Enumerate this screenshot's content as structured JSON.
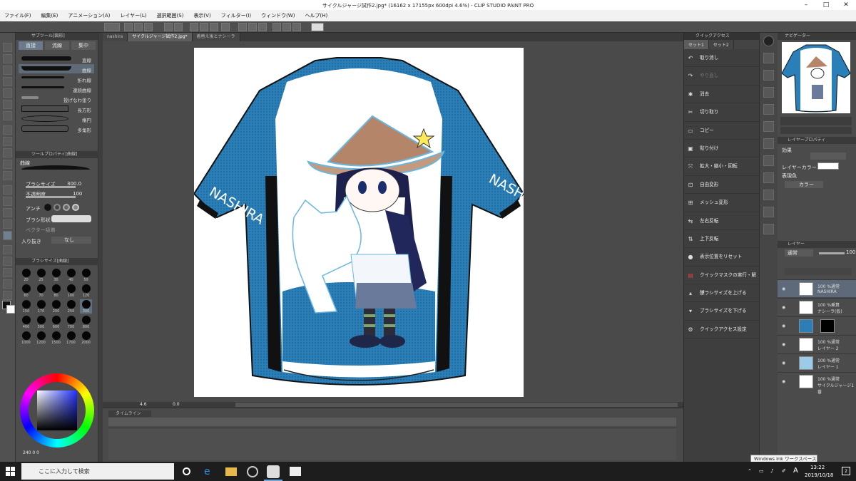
{
  "title": "サイクルジャージ試作2.jpg* (16162 x 17155px 600dpi 4.6%) - CLIP STUDIO PAINT PRO",
  "menu": [
    "ファイル(F)",
    "編集(E)",
    "アニメーション(A)",
    "レイヤー(L)",
    "選択範囲(S)",
    "表示(V)",
    "フィルター(I)",
    "ウィンドウ(W)",
    "ヘルプ(H)"
  ],
  "tabs": [
    "nashira",
    "サイクルジャージ試作2.jpg*",
    "着替え後とナシーラ"
  ],
  "subtool": {
    "header": "サブツール[図形]",
    "tabs": [
      "直接",
      "流線",
      "集中"
    ],
    "items": [
      "直線",
      "曲線",
      "折れ線",
      "連続曲線",
      "投げなわ塗り",
      "長方形",
      "楕円",
      "多角形"
    ]
  },
  "toolprop": {
    "header": "ツールプロパティ[曲線]",
    "name": "曲線",
    "brush_size_label": "ブラシサイズ",
    "brush_size_value": "300.0",
    "opacity_label": "不透明度",
    "opacity_value": "100",
    "antialias_label": "アンチ",
    "brush_shape_label": "ブラシ形状",
    "vector_label": "ベクター吸着",
    "taper_label": "入り抜き",
    "taper_value": "なし"
  },
  "brushsize": {
    "header": "ブラシサイズ[曲線]",
    "sizes": [
      "20",
      "25",
      "30",
      "40",
      "50",
      "60",
      "70",
      "80",
      "100",
      "120",
      "150",
      "170",
      "200",
      "250",
      "300",
      "400",
      "500",
      "600",
      "700",
      "800",
      "1000",
      "1200",
      "1500",
      "1700",
      "2000"
    ]
  },
  "navigator_bottom": {
    "zoom": "4.6",
    "angle": "0.0",
    "color_nums": [
      "240",
      "0",
      "0"
    ]
  },
  "timeline_header": "タイムライン",
  "quickaccess": {
    "header": "クイックアクセス",
    "tabs": [
      "セット1",
      "セット2"
    ],
    "items": [
      {
        "icon": "↶",
        "label": "取り消し",
        "dim": false
      },
      {
        "icon": "↷",
        "label": "やり直し",
        "dim": true
      },
      {
        "icon": "✱",
        "label": "消去",
        "dim": false
      },
      {
        "icon": "✂",
        "label": "切り取り",
        "dim": false
      },
      {
        "icon": "▭",
        "label": "コピー",
        "dim": false
      },
      {
        "icon": "▣",
        "label": "貼り付け",
        "dim": false
      },
      {
        "icon": "⤧",
        "label": "拡大・縮小・回転",
        "dim": false
      },
      {
        "icon": "⊡",
        "label": "自由変形",
        "dim": false
      },
      {
        "icon": "⊞",
        "label": "メッシュ変形",
        "dim": false
      },
      {
        "icon": "⇆",
        "label": "左右反転",
        "dim": false
      },
      {
        "icon": "⇅",
        "label": "上下反転",
        "dim": false
      },
      {
        "icon": "●",
        "label": "表示位置をリセット",
        "dim": false
      },
      {
        "icon": "▤",
        "label": "クイックマスクの実行・解除",
        "dim": false
      },
      {
        "icon": "▴",
        "label": "ブラシサイズを上げる",
        "dim": false
      },
      {
        "icon": "▾",
        "label": "ブラシサイズを下げる",
        "dim": false
      },
      {
        "icon": "⚙",
        "label": "クイックアクセス設定",
        "dim": false
      }
    ]
  },
  "navigator": {
    "header": "ナビゲーター"
  },
  "layerprop": {
    "header": "レイヤープロパティ",
    "effect_label": "効果",
    "layercolor_label": "レイヤーカラー",
    "expression_label": "表現色",
    "expression_value": "カラー"
  },
  "layers": {
    "header": "レイヤー",
    "blend": "通常",
    "opacity": "100",
    "items": [
      {
        "l1": "100 %通常",
        "l2": "NASHIRA",
        "sel": true
      },
      {
        "l1": "100 %乗算",
        "l2": "ナシーラ(仮)",
        "sel": false
      },
      {
        "l1": "",
        "l2": "",
        "sel": false
      },
      {
        "l1": "100 %通常",
        "l2": "レイヤー 2",
        "sel": false
      },
      {
        "l1": "100 %通常",
        "l2": "レイヤー 1",
        "sel": false
      },
      {
        "l1": "100 %通常",
        "l2": "サイクルジャージ1番",
        "sel": false
      }
    ]
  },
  "jersey": {
    "left_text": "NASHIRA",
    "right_text": "NASHIRA",
    "primary": "#2a7fb8",
    "dark": "#111111"
  },
  "taskbar": {
    "search_placeholder": "ここに入力して検索",
    "time": "13:22",
    "date": "2019/10/18",
    "ime": "A",
    "notif": "2",
    "tooltip": "Windows Ink ワークスペース"
  }
}
